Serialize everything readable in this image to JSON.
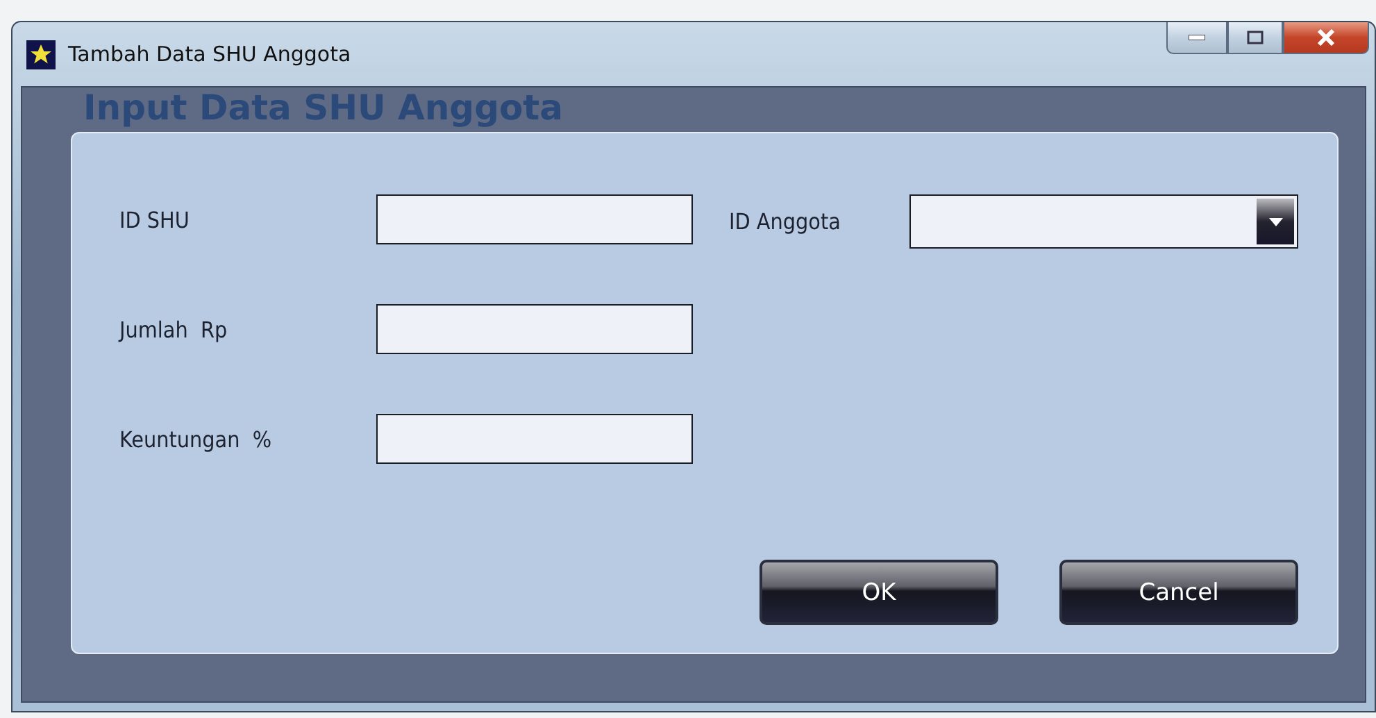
{
  "window": {
    "title": "Tambah Data SHU Anggota"
  },
  "group": {
    "title": "Input Data SHU Anggota"
  },
  "left_fields": [
    {
      "label": "ID SHU",
      "kind": "text"
    },
    {
      "label": "Jumlah  Rp",
      "kind": "text"
    },
    {
      "label": "Keuntungan  %",
      "kind": "text"
    }
  ],
  "right_fields": [
    {
      "label": "ID Anggota",
      "kind": "combo"
    }
  ],
  "buttons": [
    "OK",
    "Cancel"
  ]
}
